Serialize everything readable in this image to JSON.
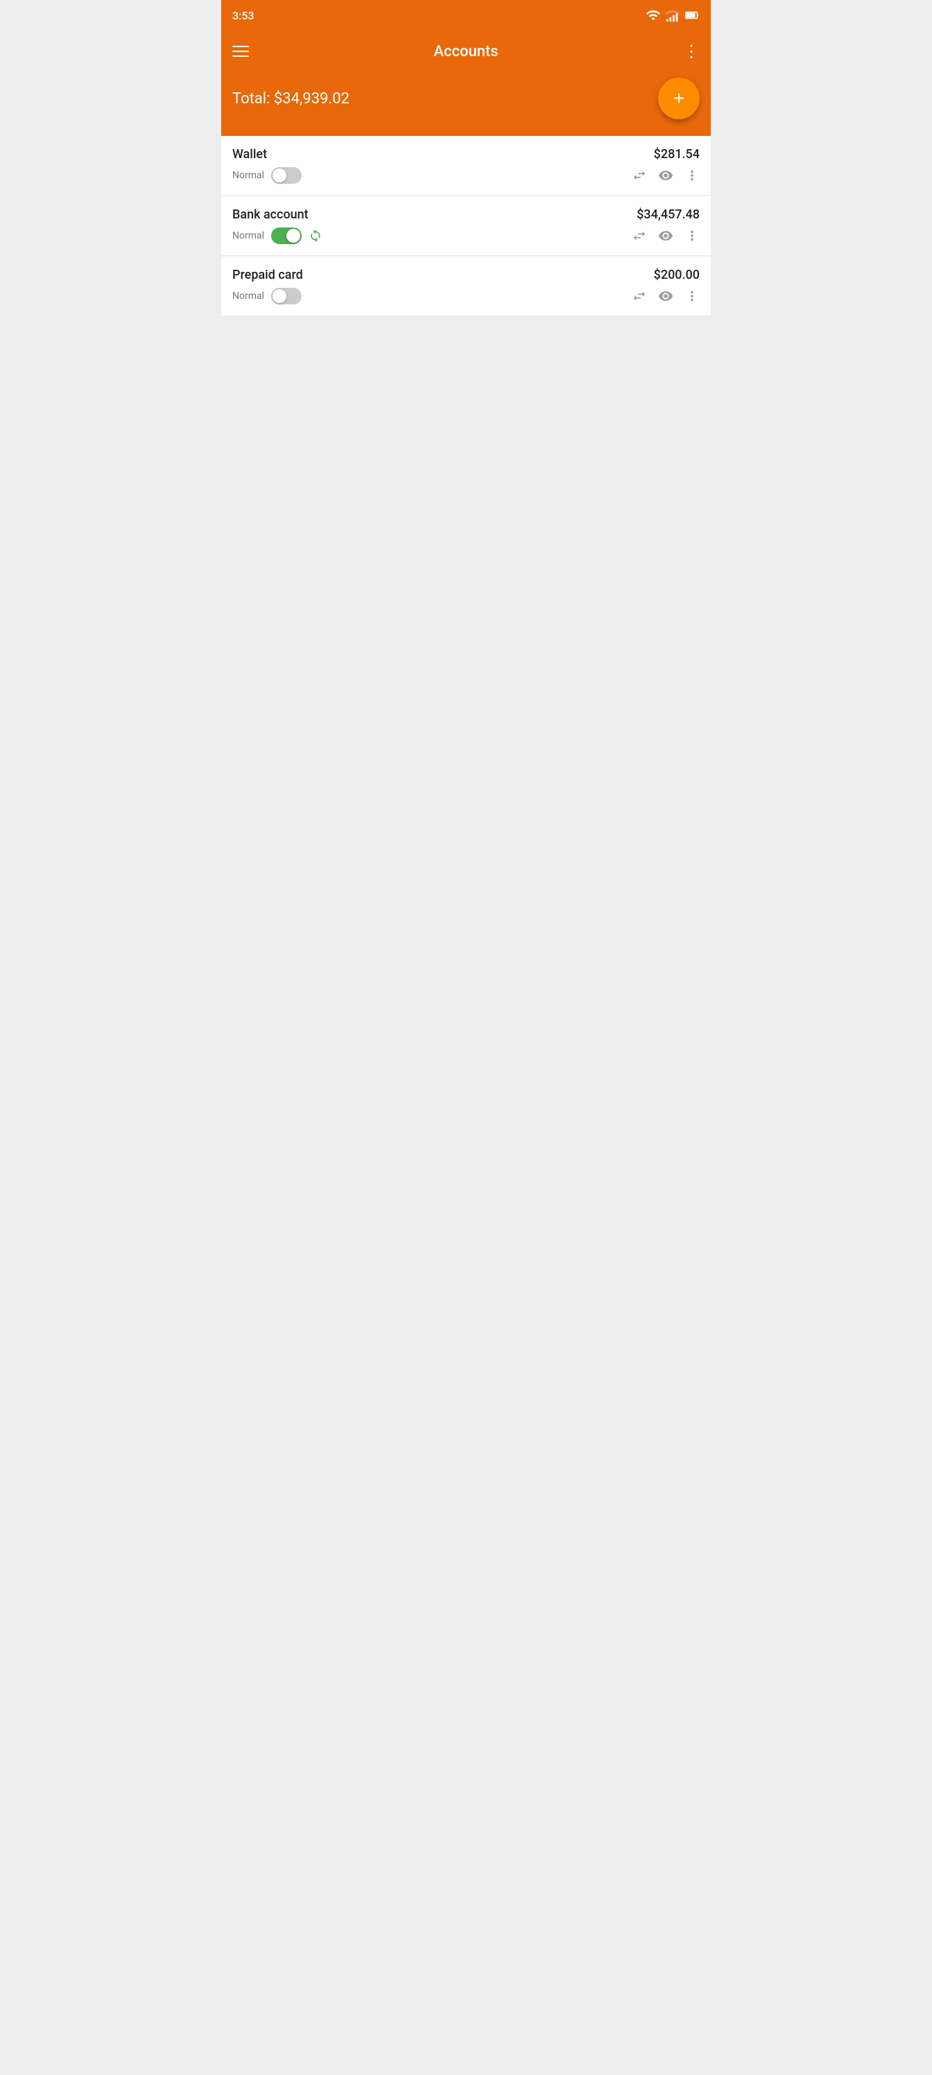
{
  "statusBar": {
    "time": "3:53",
    "icons": [
      "wifi",
      "signal",
      "battery"
    ]
  },
  "toolbar": {
    "title": "Accounts",
    "menuIcon": "⋮"
  },
  "header": {
    "totalLabel": "Total: $34,939.02"
  },
  "fab": {
    "label": "+"
  },
  "accounts": [
    {
      "id": "wallet",
      "name": "Wallet",
      "amount": "$281.54",
      "type": "Normal",
      "toggleActive": false,
      "syncActive": false
    },
    {
      "id": "bank-account",
      "name": "Bank account",
      "amount": "$34,457.48",
      "type": "Normal",
      "toggleActive": true,
      "syncActive": true
    },
    {
      "id": "prepaid-card",
      "name": "Prepaid card",
      "amount": "$200.00",
      "type": "Normal",
      "toggleActive": false,
      "syncActive": false
    }
  ]
}
